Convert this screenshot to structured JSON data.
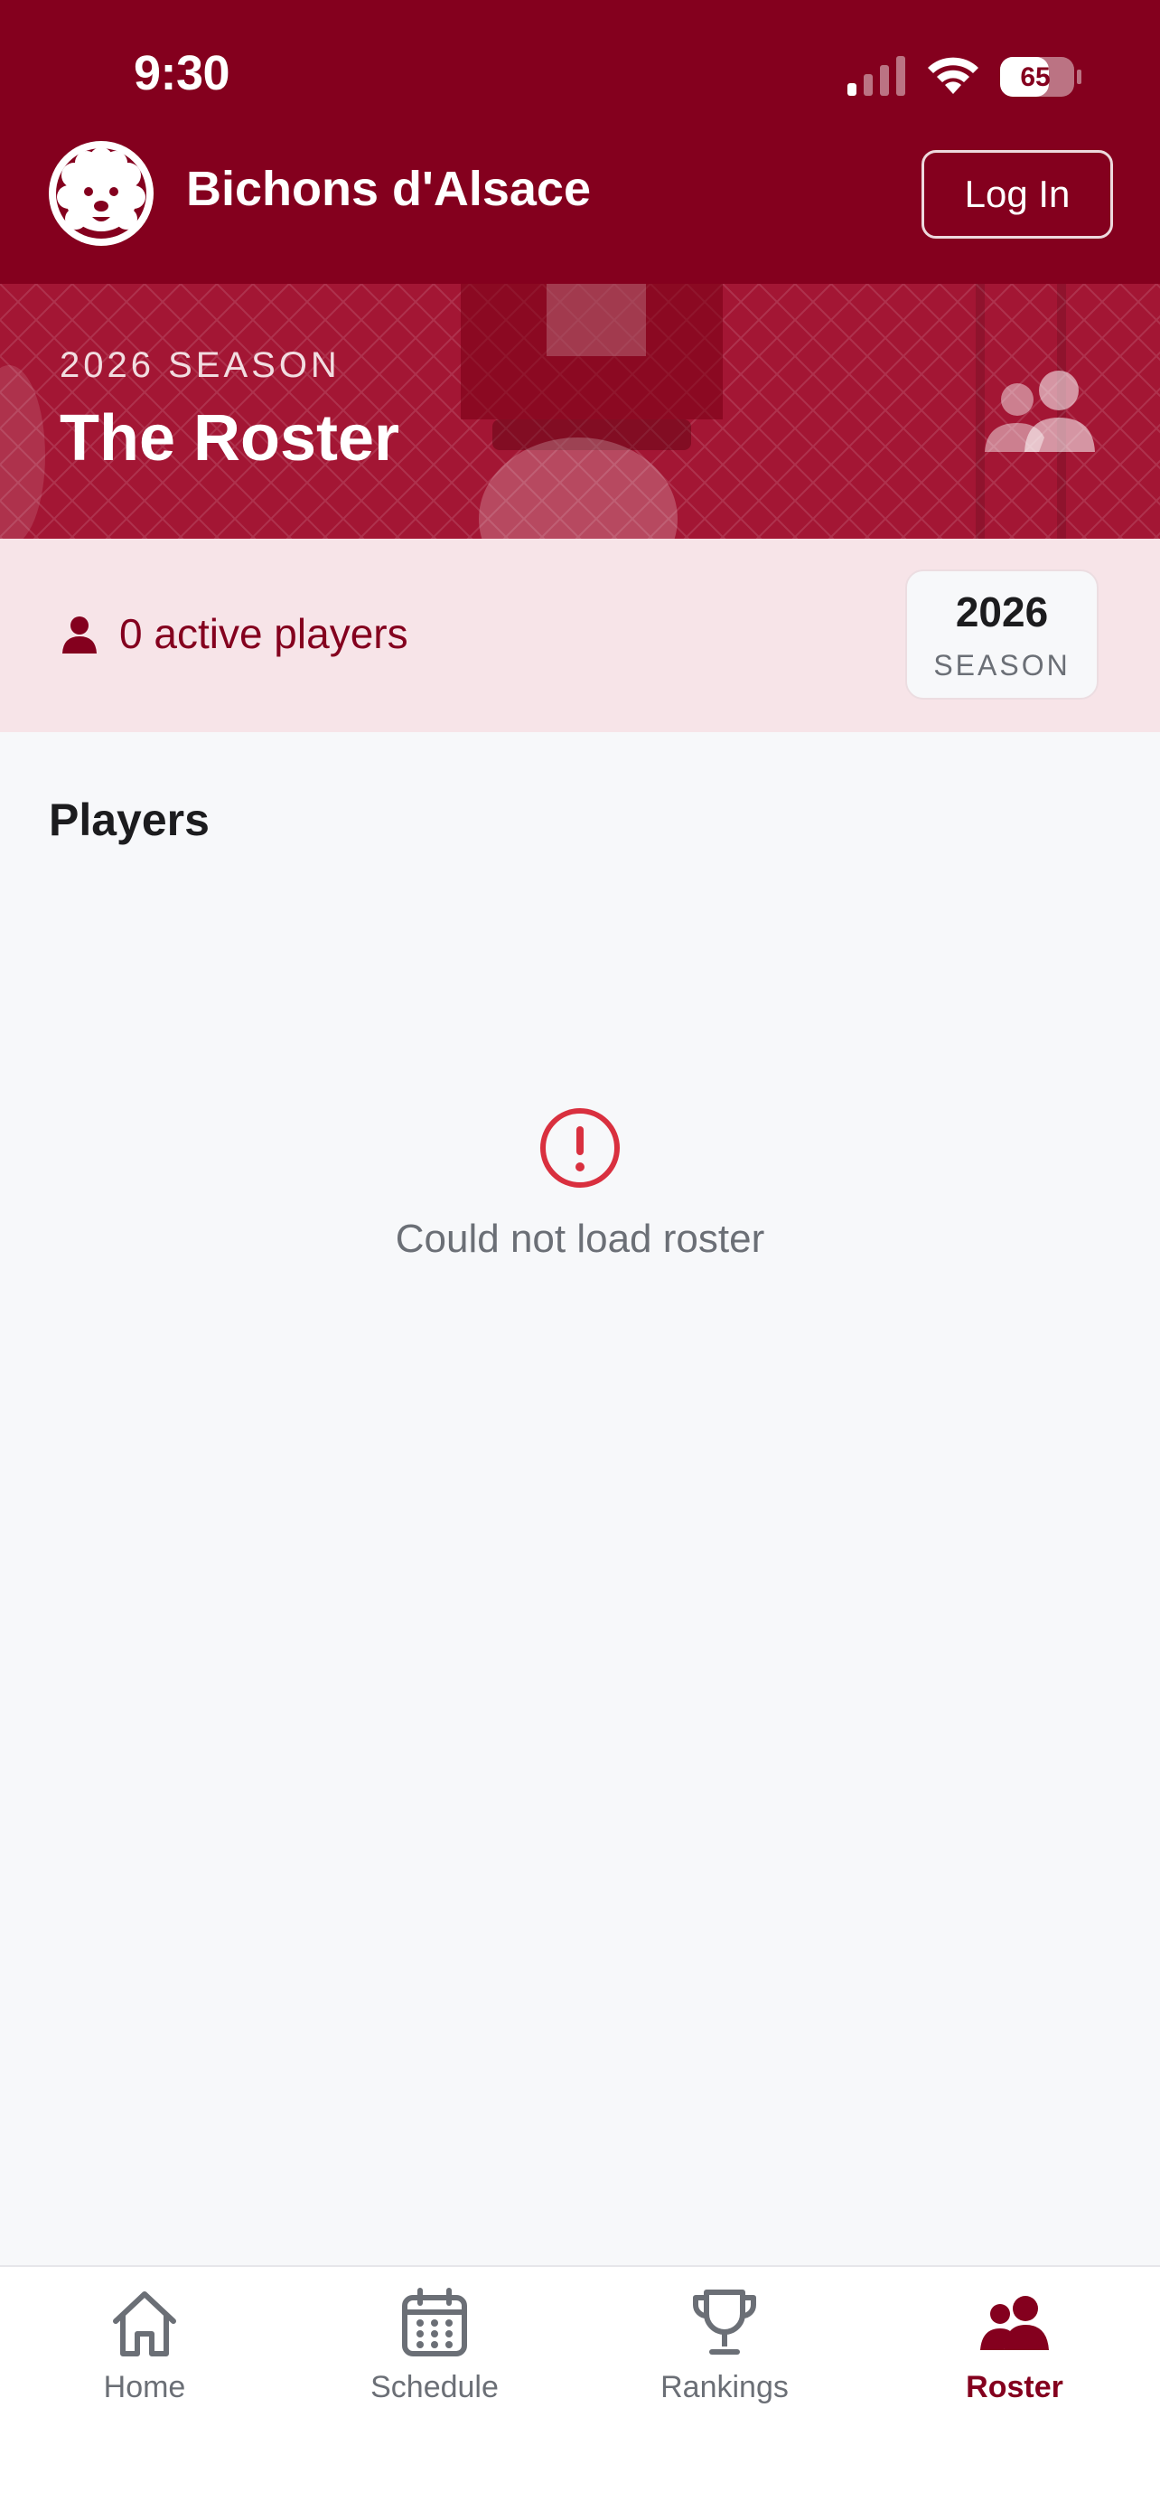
{
  "status_bar": {
    "time": "9:30",
    "battery": "65"
  },
  "header": {
    "brand": "Bichons d'Alsace",
    "login_label": "Log In"
  },
  "hero": {
    "kicker": "2026 SEASON",
    "title": "The Roster"
  },
  "summary": {
    "active_players": "0 active players",
    "season_year": "2026",
    "season_label": "SEASON"
  },
  "players": {
    "section_title": "Players",
    "error_message": "Could not load roster"
  },
  "tabs": [
    {
      "label": "Home",
      "icon": "home-icon"
    },
    {
      "label": "Schedule",
      "icon": "calendar-icon"
    },
    {
      "label": "Rankings",
      "icon": "trophy-icon"
    },
    {
      "label": "Roster",
      "icon": "people-icon"
    }
  ],
  "active_tab": "Roster",
  "colors": {
    "brand": "#84001e",
    "summary_bg": "#f7e4e8",
    "error": "#d9303f",
    "page_bg": "#f7f8fa"
  }
}
